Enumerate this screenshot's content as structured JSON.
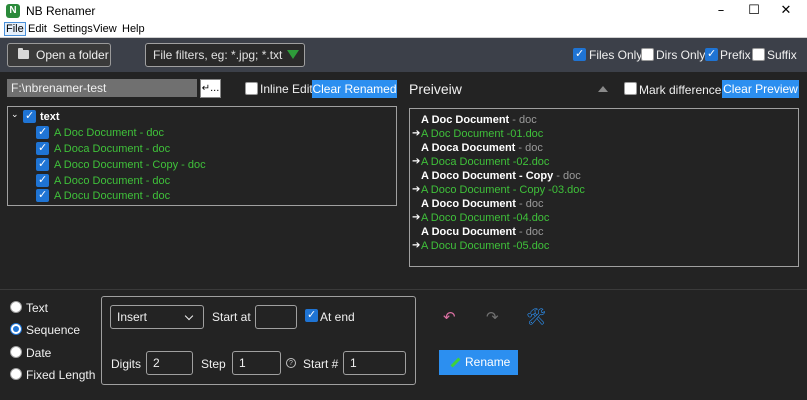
{
  "window": {
    "title": "NB Renamer",
    "minimize": "–",
    "maximize": "☐",
    "close": "✕",
    "app_icon": "N"
  },
  "menu": [
    {
      "label": "File",
      "active": true
    },
    {
      "label": "Edit"
    },
    {
      "label": "Settings"
    },
    {
      "label": "View"
    },
    {
      "label": "Help"
    }
  ],
  "toolbar": {
    "open_folder": "Open a folder",
    "filter_placeholder": "File filters, eg: *.jpg; *.txt",
    "files_only": {
      "label": "Files Only",
      "checked": true
    },
    "dirs_only": {
      "label": "Dirs Only",
      "checked": false
    },
    "prefix": {
      "label": "Prefix",
      "checked": true
    },
    "suffix": {
      "label": "Suffix",
      "checked": false
    }
  },
  "left": {
    "path": "F:\\nbrenamer-test",
    "browse": "...",
    "inline_edit": {
      "label": "Inline Edit",
      "checked": false
    },
    "clear_renamed": "Clear Renamed",
    "tree": {
      "root": "text",
      "items": [
        "A Doc Document - doc",
        "A Doca Document - doc",
        "A Doco Document - Copy - doc",
        "A Doco Document - doc",
        "A Docu Document - doc"
      ]
    }
  },
  "preview": {
    "title": "Preiveiw",
    "mark_differences": {
      "label": "Mark differences",
      "checked": false
    },
    "clear_preview": "Clear Preview",
    "rows": [
      {
        "name": "A Doc Document",
        "sep": " - ",
        "ext": "doc",
        "renamed": false
      },
      {
        "name": "A Doc Document -01",
        "sep": ".",
        "ext": "doc",
        "renamed": true
      },
      {
        "name": "A Doca Document",
        "sep": " - ",
        "ext": "doc",
        "renamed": false
      },
      {
        "name": "A Doca Document -02",
        "sep": ".",
        "ext": "doc",
        "renamed": true
      },
      {
        "name": "A Doco Document - Copy",
        "sep": " - ",
        "ext": "doc",
        "renamed": false
      },
      {
        "name": "A Doco Document - Copy -03",
        "sep": ".",
        "ext": "doc",
        "renamed": true
      },
      {
        "name": "A Doco Document",
        "sep": " - ",
        "ext": "doc",
        "renamed": false
      },
      {
        "name": "A Doco Document -04",
        "sep": ".",
        "ext": "doc",
        "renamed": true
      },
      {
        "name": "A Docu Document",
        "sep": " - ",
        "ext": "doc",
        "renamed": false
      },
      {
        "name": "A Docu Document -05",
        "sep": ".",
        "ext": "doc",
        "renamed": true
      }
    ]
  },
  "modes": {
    "selected": "Sequence",
    "options": [
      "Text",
      "Sequence",
      "Date",
      "Fixed Length"
    ]
  },
  "sequence": {
    "mode": "Insert",
    "start_at_label": "Start at",
    "start_at_value": "",
    "at_end": {
      "label": "At end",
      "checked": true
    },
    "digits_label": "Digits",
    "digits": "2",
    "step_label": "Step",
    "step": "1",
    "help": "?",
    "start_num_label": "Start #",
    "start_num": "1"
  },
  "actions": {
    "undo": "↶",
    "redo": "↷",
    "tools": "🛠",
    "rename": "Rename"
  },
  "colors": {
    "accent": "#2c8ff0",
    "renamed_text": "#3fc13a",
    "toolbar_bg": "#3c4049",
    "bg": "#232323"
  }
}
